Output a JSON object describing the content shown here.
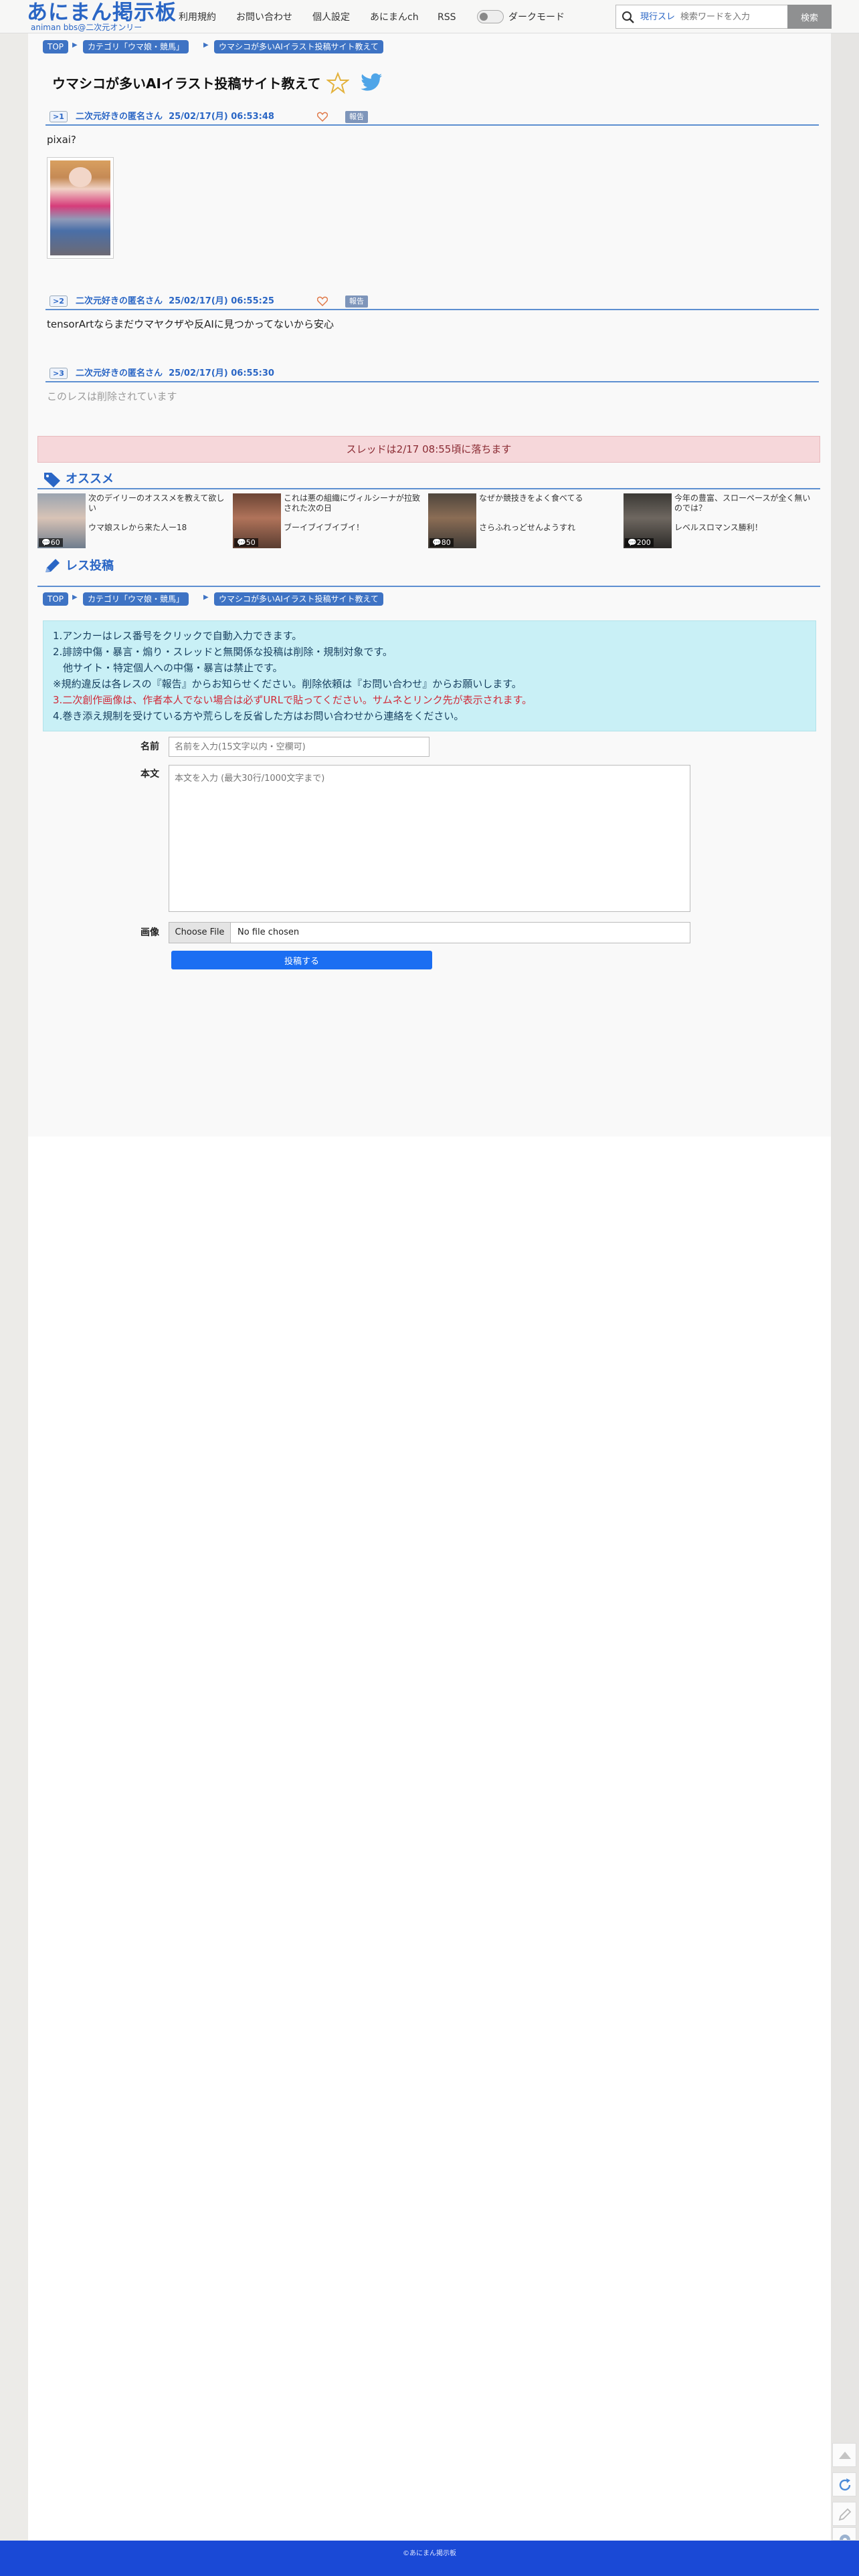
{
  "site": {
    "logo_main": "あにまん掲示板",
    "logo_sub": "animan bbs@二次元オンリー"
  },
  "nav": {
    "items": [
      "利用規約",
      "お問い合わせ",
      "個人設定",
      "あにまんch",
      "RSS"
    ],
    "dark_mode_label": "ダークモード"
  },
  "search": {
    "trend_label": "現行スレ",
    "placeholder": "検索ワードを入力",
    "button_label": "検索"
  },
  "breadcrumb": {
    "top": "TOP",
    "category": "カテゴリ「ウマ娘・競馬」",
    "current": "ウマシコが多いAIイラスト投稿サイト教えて"
  },
  "thread": {
    "title": "ウマシコが多いAIイラスト投稿サイト教えて"
  },
  "posts": [
    {
      "number": "1",
      "name": "二次元好きの匿名さん",
      "date": "25/02/17(月) 06:53:48",
      "report_label": "報告",
      "body": "pixai?"
    },
    {
      "number": "2",
      "name": "二次元好きの匿名さん",
      "date": "25/02/17(月) 06:55:25",
      "report_label": "報告",
      "body": "tensorArtならまだウマヤクザや反AIに見つかってないから安心"
    },
    {
      "number": "3",
      "name": "二次元好きの匿名さん",
      "date": "25/02/17(月) 06:55:30",
      "body": "このレスは削除されています"
    }
  ],
  "notice": "スレッドは2/17 08:55頃に落ちます",
  "recommend": {
    "title": "オススメ",
    "items": [
      {
        "title": "次のデイリーのオススメを教えて欲しい",
        "subtitle": "ウマ娘スレから来た人ー18",
        "count": "60",
        "thumb_color": "#8c9aa8"
      },
      {
        "title": "これは悪の組織にヴィルシーナが拉致された次の日",
        "subtitle": "ブーイブイブイブイ！",
        "count": "50",
        "thumb_color": "#8a5a43"
      },
      {
        "title": "なぜか競技きをよく食べてる",
        "subtitle": "さらふれっどせんようすれ",
        "count": "80",
        "thumb_color": "#6f6253"
      },
      {
        "title": "今年の豊富、スローペースが全く無いのでは？",
        "subtitle": "レベルスロマンス勝利！",
        "count": "200",
        "thumb_color": "#4d4a45"
      }
    ]
  },
  "reply": {
    "title": "レス投稿",
    "rules": [
      "1.アンカーはレス番号をクリックで自動入力できます。",
      "2.誹謗中傷・暴言・煽り・スレッドと無関係な投稿は削除・規制対象です。",
      "　他サイト・特定個人への中傷・暴言は禁止です。",
      "※規約違反は各レスの『報告』からお知らせください。削除依頼は『お問い合わせ』からお願いします。",
      "3.二次創作画像は、作者本人でない場合は必ずURLで貼ってください。サムネとリンク先が表示されます。",
      "4.巻き添え規制を受けている方や荒らしを反省した方はお問い合わせから連絡をください。"
    ],
    "name_label": "名前",
    "name_placeholder": "名前を入力(15文字以内・空欄可)",
    "body_label": "本文",
    "body_placeholder": "本文を入力 (最大30行/1000文字まで)",
    "image_label": "画像",
    "file_button": "Choose File",
    "file_status": "No file chosen",
    "submit_label": "投稿する"
  },
  "footer": {
    "copyright": "©あにまん掲示板"
  },
  "colors": {
    "accent": "#2a66c5",
    "notice_bg": "#f6d7da",
    "rules_bg": "#c9f0f6",
    "submit": "#1b6ef2",
    "footer": "#1a49d6"
  }
}
